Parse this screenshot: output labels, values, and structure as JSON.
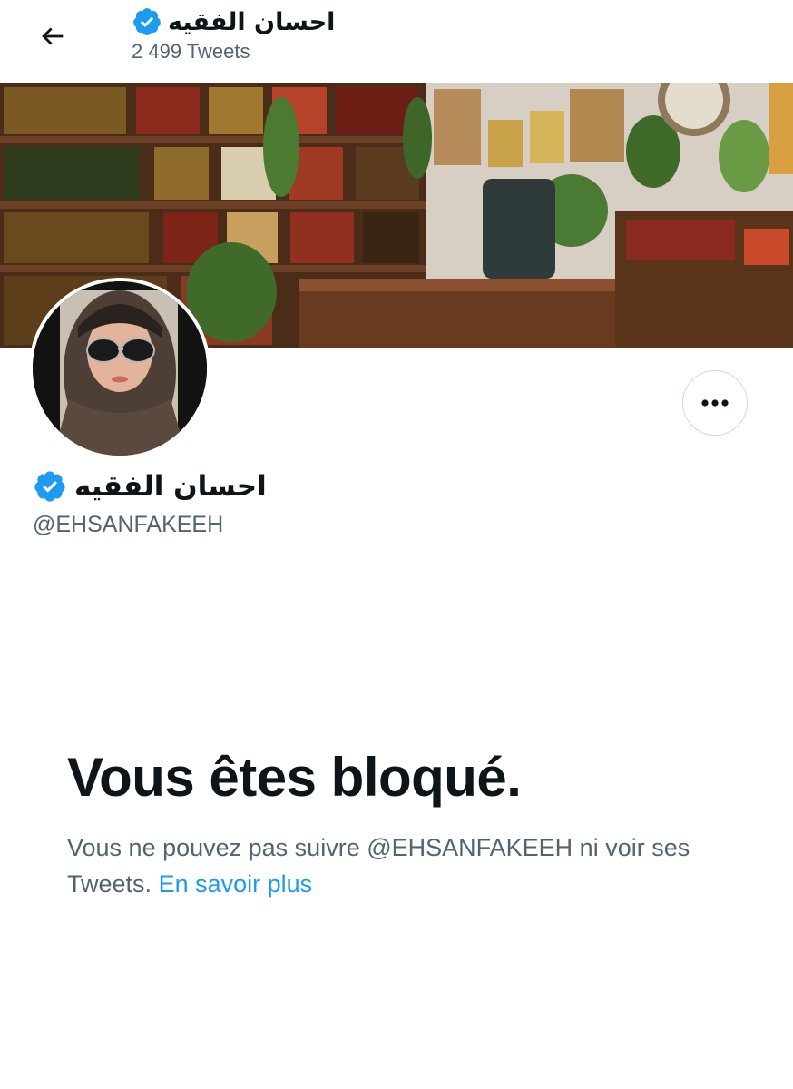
{
  "header": {
    "back_icon": "arrow-left-icon",
    "name": "احسان الفقيه",
    "tweet_count": "2 499 Tweets",
    "verified_icon": "verified-badge-icon"
  },
  "banner": {
    "description_icon": "bookshelf-office-photo"
  },
  "profile": {
    "name": "احسان الفقيه",
    "handle": "@EHSANFAKEEH",
    "more_icon": "more-dots-icon"
  },
  "blocked": {
    "title": "Vous êtes bloqué.",
    "message": "Vous ne pouvez pas suivre @EHSANFAKEEH ni voir ses Tweets.",
    "link": "En savoir plus"
  },
  "colors": {
    "accent": "#1d9bf0",
    "text": "#0f1419",
    "secondary": "#536471",
    "border": "#cfd9de"
  }
}
